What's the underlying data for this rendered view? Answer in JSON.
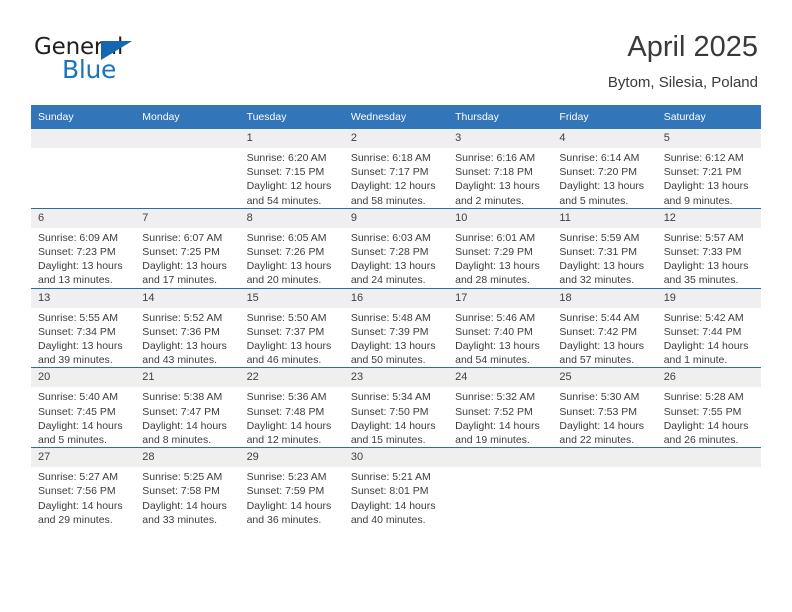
{
  "brand": {
    "name_dark": "General",
    "name_blue": "Blue",
    "accent_color": "#1b75bc"
  },
  "header": {
    "month_title": "April 2025",
    "location": "Bytom, Silesia, Poland"
  },
  "theme": {
    "header_bg": "#3275b8",
    "day_number_bg": "#efefef",
    "row_divider": "#2b6ca8"
  },
  "weekday_headers": [
    "Sunday",
    "Monday",
    "Tuesday",
    "Wednesday",
    "Thursday",
    "Friday",
    "Saturday"
  ],
  "weeks": [
    [
      {
        "day": "",
        "sunrise": "",
        "sunset": "",
        "daylight_a": "",
        "daylight_b": ""
      },
      {
        "day": "",
        "sunrise": "",
        "sunset": "",
        "daylight_a": "",
        "daylight_b": ""
      },
      {
        "day": "1",
        "sunrise": "Sunrise: 6:20 AM",
        "sunset": "Sunset: 7:15 PM",
        "daylight_a": "Daylight: 12 hours",
        "daylight_b": "and 54 minutes."
      },
      {
        "day": "2",
        "sunrise": "Sunrise: 6:18 AM",
        "sunset": "Sunset: 7:17 PM",
        "daylight_a": "Daylight: 12 hours",
        "daylight_b": "and 58 minutes."
      },
      {
        "day": "3",
        "sunrise": "Sunrise: 6:16 AM",
        "sunset": "Sunset: 7:18 PM",
        "daylight_a": "Daylight: 13 hours",
        "daylight_b": "and 2 minutes."
      },
      {
        "day": "4",
        "sunrise": "Sunrise: 6:14 AM",
        "sunset": "Sunset: 7:20 PM",
        "daylight_a": "Daylight: 13 hours",
        "daylight_b": "and 5 minutes."
      },
      {
        "day": "5",
        "sunrise": "Sunrise: 6:12 AM",
        "sunset": "Sunset: 7:21 PM",
        "daylight_a": "Daylight: 13 hours",
        "daylight_b": "and 9 minutes."
      }
    ],
    [
      {
        "day": "6",
        "sunrise": "Sunrise: 6:09 AM",
        "sunset": "Sunset: 7:23 PM",
        "daylight_a": "Daylight: 13 hours",
        "daylight_b": "and 13 minutes."
      },
      {
        "day": "7",
        "sunrise": "Sunrise: 6:07 AM",
        "sunset": "Sunset: 7:25 PM",
        "daylight_a": "Daylight: 13 hours",
        "daylight_b": "and 17 minutes."
      },
      {
        "day": "8",
        "sunrise": "Sunrise: 6:05 AM",
        "sunset": "Sunset: 7:26 PM",
        "daylight_a": "Daylight: 13 hours",
        "daylight_b": "and 20 minutes."
      },
      {
        "day": "9",
        "sunrise": "Sunrise: 6:03 AM",
        "sunset": "Sunset: 7:28 PM",
        "daylight_a": "Daylight: 13 hours",
        "daylight_b": "and 24 minutes."
      },
      {
        "day": "10",
        "sunrise": "Sunrise: 6:01 AM",
        "sunset": "Sunset: 7:29 PM",
        "daylight_a": "Daylight: 13 hours",
        "daylight_b": "and 28 minutes."
      },
      {
        "day": "11",
        "sunrise": "Sunrise: 5:59 AM",
        "sunset": "Sunset: 7:31 PM",
        "daylight_a": "Daylight: 13 hours",
        "daylight_b": "and 32 minutes."
      },
      {
        "day": "12",
        "sunrise": "Sunrise: 5:57 AM",
        "sunset": "Sunset: 7:33 PM",
        "daylight_a": "Daylight: 13 hours",
        "daylight_b": "and 35 minutes."
      }
    ],
    [
      {
        "day": "13",
        "sunrise": "Sunrise: 5:55 AM",
        "sunset": "Sunset: 7:34 PM",
        "daylight_a": "Daylight: 13 hours",
        "daylight_b": "and 39 minutes."
      },
      {
        "day": "14",
        "sunrise": "Sunrise: 5:52 AM",
        "sunset": "Sunset: 7:36 PM",
        "daylight_a": "Daylight: 13 hours",
        "daylight_b": "and 43 minutes."
      },
      {
        "day": "15",
        "sunrise": "Sunrise: 5:50 AM",
        "sunset": "Sunset: 7:37 PM",
        "daylight_a": "Daylight: 13 hours",
        "daylight_b": "and 46 minutes."
      },
      {
        "day": "16",
        "sunrise": "Sunrise: 5:48 AM",
        "sunset": "Sunset: 7:39 PM",
        "daylight_a": "Daylight: 13 hours",
        "daylight_b": "and 50 minutes."
      },
      {
        "day": "17",
        "sunrise": "Sunrise: 5:46 AM",
        "sunset": "Sunset: 7:40 PM",
        "daylight_a": "Daylight: 13 hours",
        "daylight_b": "and 54 minutes."
      },
      {
        "day": "18",
        "sunrise": "Sunrise: 5:44 AM",
        "sunset": "Sunset: 7:42 PM",
        "daylight_a": "Daylight: 13 hours",
        "daylight_b": "and 57 minutes."
      },
      {
        "day": "19",
        "sunrise": "Sunrise: 5:42 AM",
        "sunset": "Sunset: 7:44 PM",
        "daylight_a": "Daylight: 14 hours",
        "daylight_b": "and 1 minute."
      }
    ],
    [
      {
        "day": "20",
        "sunrise": "Sunrise: 5:40 AM",
        "sunset": "Sunset: 7:45 PM",
        "daylight_a": "Daylight: 14 hours",
        "daylight_b": "and 5 minutes."
      },
      {
        "day": "21",
        "sunrise": "Sunrise: 5:38 AM",
        "sunset": "Sunset: 7:47 PM",
        "daylight_a": "Daylight: 14 hours",
        "daylight_b": "and 8 minutes."
      },
      {
        "day": "22",
        "sunrise": "Sunrise: 5:36 AM",
        "sunset": "Sunset: 7:48 PM",
        "daylight_a": "Daylight: 14 hours",
        "daylight_b": "and 12 minutes."
      },
      {
        "day": "23",
        "sunrise": "Sunrise: 5:34 AM",
        "sunset": "Sunset: 7:50 PM",
        "daylight_a": "Daylight: 14 hours",
        "daylight_b": "and 15 minutes."
      },
      {
        "day": "24",
        "sunrise": "Sunrise: 5:32 AM",
        "sunset": "Sunset: 7:52 PM",
        "daylight_a": "Daylight: 14 hours",
        "daylight_b": "and 19 minutes."
      },
      {
        "day": "25",
        "sunrise": "Sunrise: 5:30 AM",
        "sunset": "Sunset: 7:53 PM",
        "daylight_a": "Daylight: 14 hours",
        "daylight_b": "and 22 minutes."
      },
      {
        "day": "26",
        "sunrise": "Sunrise: 5:28 AM",
        "sunset": "Sunset: 7:55 PM",
        "daylight_a": "Daylight: 14 hours",
        "daylight_b": "and 26 minutes."
      }
    ],
    [
      {
        "day": "27",
        "sunrise": "Sunrise: 5:27 AM",
        "sunset": "Sunset: 7:56 PM",
        "daylight_a": "Daylight: 14 hours",
        "daylight_b": "and 29 minutes."
      },
      {
        "day": "28",
        "sunrise": "Sunrise: 5:25 AM",
        "sunset": "Sunset: 7:58 PM",
        "daylight_a": "Daylight: 14 hours",
        "daylight_b": "and 33 minutes."
      },
      {
        "day": "29",
        "sunrise": "Sunrise: 5:23 AM",
        "sunset": "Sunset: 7:59 PM",
        "daylight_a": "Daylight: 14 hours",
        "daylight_b": "and 36 minutes."
      },
      {
        "day": "30",
        "sunrise": "Sunrise: 5:21 AM",
        "sunset": "Sunset: 8:01 PM",
        "daylight_a": "Daylight: 14 hours",
        "daylight_b": "and 40 minutes."
      },
      {
        "day": "",
        "sunrise": "",
        "sunset": "",
        "daylight_a": "",
        "daylight_b": ""
      },
      {
        "day": "",
        "sunrise": "",
        "sunset": "",
        "daylight_a": "",
        "daylight_b": ""
      },
      {
        "day": "",
        "sunrise": "",
        "sunset": "",
        "daylight_a": "",
        "daylight_b": ""
      }
    ]
  ]
}
